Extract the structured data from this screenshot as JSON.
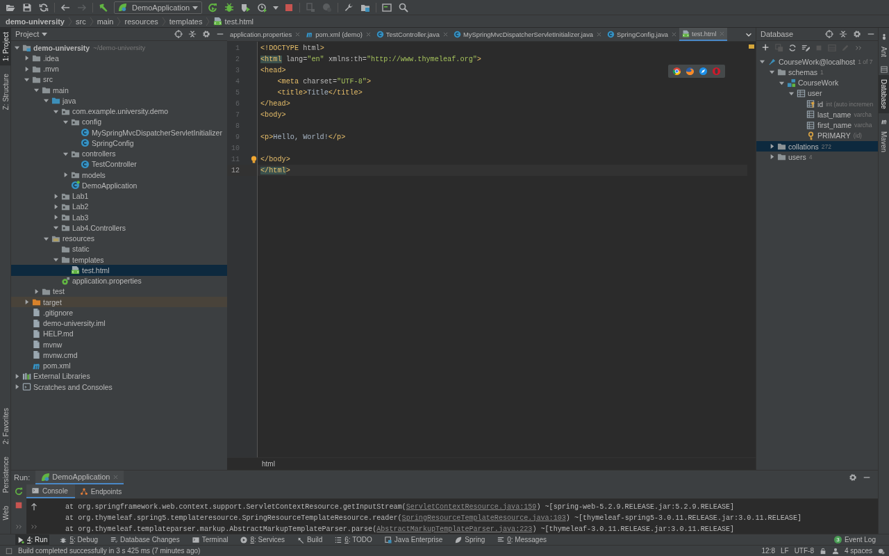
{
  "toolbar": {
    "run_configuration": "DemoApplication"
  },
  "breadcrumbs": [
    {
      "label": "demo-university"
    },
    {
      "label": "src"
    },
    {
      "label": "main"
    },
    {
      "label": "resources"
    },
    {
      "label": "templates"
    },
    {
      "label": "test.html",
      "kind": "html"
    }
  ],
  "left_stripe": {
    "top": [
      {
        "label": "1: Project",
        "selected": true
      },
      {
        "label": "Z: Structure",
        "selected": false
      }
    ],
    "bottom": [
      {
        "label": "2: Favorites",
        "selected": false
      },
      {
        "label": "Persistence",
        "selected": false
      },
      {
        "label": "Web",
        "selected": false
      }
    ]
  },
  "project": {
    "title": "Project",
    "tree": [
      {
        "label": "demo-university",
        "hint": "~/demo-university",
        "kind": "module",
        "expanded": true,
        "selected": false,
        "children": [
          {
            "label": ".idea",
            "kind": "folder",
            "expanded": false,
            "selected": false
          },
          {
            "label": ".mvn",
            "kind": "folder",
            "expanded": false,
            "selected": false
          },
          {
            "label": "src",
            "kind": "folder",
            "expanded": true,
            "selected": false,
            "children": [
              {
                "label": "main",
                "kind": "folder",
                "expanded": true,
                "selected": false,
                "children": [
                  {
                    "label": "java",
                    "kind": "source-folder",
                    "expanded": true,
                    "selected": false,
                    "children": [
                      {
                        "label": "com.example.university.demo",
                        "kind": "package",
                        "expanded": true,
                        "selected": false,
                        "children": [
                          {
                            "label": "config",
                            "kind": "package",
                            "expanded": true,
                            "selected": false,
                            "children": [
                              {
                                "label": "MySpringMvcDispatcherServletInitializer",
                                "kind": "class",
                                "selected": false
                              },
                              {
                                "label": "SpringConfig",
                                "kind": "class",
                                "selected": false
                              }
                            ]
                          },
                          {
                            "label": "controllers",
                            "kind": "package",
                            "expanded": true,
                            "selected": false,
                            "children": [
                              {
                                "label": "TestController",
                                "kind": "class",
                                "selected": false
                              }
                            ]
                          },
                          {
                            "label": "models",
                            "kind": "package",
                            "expanded": false,
                            "selected": false
                          },
                          {
                            "label": "DemoApplication",
                            "kind": "app-class",
                            "selected": false
                          }
                        ]
                      },
                      {
                        "label": "Lab1",
                        "kind": "package",
                        "expanded": false,
                        "selected": false
                      },
                      {
                        "label": "Lab2",
                        "kind": "package",
                        "expanded": false,
                        "selected": false
                      },
                      {
                        "label": "Lab3",
                        "kind": "package",
                        "expanded": false,
                        "selected": false
                      },
                      {
                        "label": "Lab4.Controllers",
                        "kind": "package",
                        "expanded": true,
                        "selected": false
                      }
                    ]
                  },
                  {
                    "label": "resources",
                    "kind": "resources-folder",
                    "expanded": true,
                    "selected": false,
                    "children": [
                      {
                        "label": "static",
                        "kind": "folder",
                        "selected": false
                      },
                      {
                        "label": "templates",
                        "kind": "folder",
                        "expanded": true,
                        "selected": false,
                        "children": [
                          {
                            "label": "test.html",
                            "kind": "html-file",
                            "selected": true
                          }
                        ]
                      },
                      {
                        "label": "application.properties",
                        "kind": "properties-file",
                        "selected": false
                      }
                    ]
                  }
                ]
              },
              {
                "label": "test",
                "kind": "folder",
                "expanded": false,
                "selected": false
              }
            ]
          },
          {
            "label": "target",
            "kind": "excluded-folder",
            "expanded": false,
            "selected": false
          },
          {
            "label": ".gitignore",
            "kind": "text-file",
            "selected": false
          },
          {
            "label": "demo-university.iml",
            "kind": "text-file",
            "selected": false
          },
          {
            "label": "HELP.md",
            "kind": "text-file",
            "selected": false
          },
          {
            "label": "mvnw",
            "kind": "text-file",
            "selected": false
          },
          {
            "label": "mvnw.cmd",
            "kind": "text-file",
            "selected": false
          },
          {
            "label": "pom.xml",
            "kind": "maven-file",
            "selected": false
          }
        ]
      },
      {
        "label": "External Libraries",
        "kind": "library",
        "expanded": false,
        "selected": false
      },
      {
        "label": "Scratches and Consoles",
        "kind": "scratches",
        "expanded": false,
        "selected": false
      }
    ]
  },
  "editor": {
    "tabs": [
      {
        "label": "application.properties",
        "selected": false
      },
      {
        "label": "pom.xml (demo)",
        "kind": "maven",
        "selected": false
      },
      {
        "label": "TestController.java",
        "kind": "class",
        "selected": false
      },
      {
        "label": "MySpringMvcDispatcherServletInitializer.java",
        "kind": "class",
        "selected": false
      },
      {
        "label": "SpringConfig.java",
        "kind": "class",
        "selected": false
      },
      {
        "label": "test.html",
        "kind": "html",
        "selected": true
      }
    ],
    "lines": [
      {
        "number": "1",
        "text": "<!DOCTYPE html>",
        "current": false,
        "tag_match": false
      },
      {
        "number": "2",
        "text": "<html lang=\"en\" xmlns:th=\"http://www.thymeleaf.org\">",
        "current": false,
        "tag_match": true
      },
      {
        "number": "3",
        "text": "<head>",
        "current": false,
        "tag_match": false
      },
      {
        "number": "4",
        "text": "    <meta charset=\"UTF-8\">",
        "current": false,
        "tag_match": false
      },
      {
        "number": "5",
        "text": "    <title>Title</title>",
        "current": false,
        "tag_match": false
      },
      {
        "number": "6",
        "text": "</head>",
        "current": false,
        "tag_match": false
      },
      {
        "number": "7",
        "text": "<body>",
        "current": false,
        "tag_match": false
      },
      {
        "number": "8",
        "current": false
      },
      {
        "number": "9",
        "text": "<p>Hello, World!</p>",
        "current": false,
        "tag_match": false
      },
      {
        "number": "10",
        "current": false
      },
      {
        "number": "11",
        "text": "</body>",
        "current": false,
        "tag_match": false
      },
      {
        "number": "12",
        "text": "</html>",
        "current": true,
        "tag_match": true
      }
    ],
    "breadcrumb": "html"
  },
  "database": {
    "title": "Database",
    "tree": [
      {
        "label": "CourseWork@localhost",
        "hint": "1 of 7",
        "kind": "connection",
        "expanded": true,
        "selected": false,
        "children": [
          {
            "label": "schemas",
            "hint": "1",
            "kind": "folder",
            "expanded": true,
            "selected": false,
            "children": [
              {
                "label": "CourseWork",
                "kind": "schema",
                "expanded": true,
                "selected": false,
                "children": [
                  {
                    "label": "user",
                    "kind": "table",
                    "expanded": true,
                    "selected": false,
                    "children": [
                      {
                        "label": "id",
                        "hint": "int (auto incremen",
                        "kind": "key-column",
                        "selected": false
                      },
                      {
                        "label": "last_name",
                        "hint": "varcha",
                        "kind": "column",
                        "selected": false
                      },
                      {
                        "label": "first_name",
                        "hint": "varcha",
                        "kind": "column",
                        "selected": false
                      },
                      {
                        "label": "PRIMARY",
                        "hint": "(id)",
                        "kind": "key",
                        "selected": false
                      }
                    ]
                  }
                ]
              }
            ]
          },
          {
            "label": "collations",
            "hint": "272",
            "kind": "folder",
            "expanded": false,
            "selected": true
          },
          {
            "label": "users",
            "hint": "4",
            "kind": "folder",
            "expanded": false,
            "selected": false
          }
        ]
      }
    ]
  },
  "right_stripe": [
    {
      "label": "Ant",
      "selected": false
    },
    {
      "label": "Database",
      "selected": true
    },
    {
      "label": "Maven",
      "selected": false
    }
  ],
  "run": {
    "label": "Run:",
    "tab": "DemoApplication",
    "subtabs": [
      {
        "label": "Console",
        "selected": true
      },
      {
        "label": "Endpoints",
        "selected": false
      }
    ],
    "console": [
      {
        "text": "at org.springframework.web.context.support.ServletContextResource.getInputStream(",
        "link": "ServletContextResource.java:159",
        "suffix": ") ~[spring-web-5.2.9.RELEASE.jar:5.2.9.RELEASE]"
      },
      {
        "text": "at org.thymeleaf.spring5.templateresource.SpringResourceTemplateResource.reader(",
        "link": "SpringResourceTemplateResource.java:103",
        "suffix": ") ~[thymeleaf-spring5-3.0.11.RELEASE.jar:3.0.11.RELEASE]"
      },
      {
        "text": "at org.thymeleaf.templateparser.markup.AbstractMarkupTemplateParser.parse(",
        "link": "AbstractMarkupTemplateParser.java:223",
        "suffix": ") ~[thymeleaf-3.0.11.RELEASE.jar:3.0.11.RELEASE]"
      }
    ]
  },
  "tool_windows": [
    {
      "mnemonic": "4",
      "label": ": Run",
      "kind": "run",
      "selected": true
    },
    {
      "mnemonic": "5",
      "label": ": Debug",
      "kind": "debug",
      "selected": false
    },
    {
      "label": "Database Changes",
      "kind": "database-changes",
      "selected": false
    },
    {
      "label": "Terminal",
      "kind": "terminal",
      "selected": false
    },
    {
      "mnemonic": "8",
      "label": ": Services",
      "kind": "services",
      "selected": false
    },
    {
      "label": "Build",
      "kind": "build",
      "selected": false
    },
    {
      "mnemonic": "6",
      "label": ": TODO",
      "kind": "todo",
      "selected": false
    },
    {
      "label": "Java Enterprise",
      "kind": "java-enterprise",
      "selected": false
    },
    {
      "label": "Spring",
      "kind": "spring",
      "selected": false
    },
    {
      "mnemonic": "0",
      "label": ": Messages",
      "kind": "messages",
      "selected": false
    }
  ],
  "event_log": {
    "label": "Event Log",
    "badge": "3"
  },
  "status_bar": {
    "message": "Build completed successfully in 3 s 425 ms (7 minutes ago)",
    "position": "12:8",
    "line_separator": "LF",
    "encoding": "UTF-8",
    "indent": "4 spaces"
  }
}
